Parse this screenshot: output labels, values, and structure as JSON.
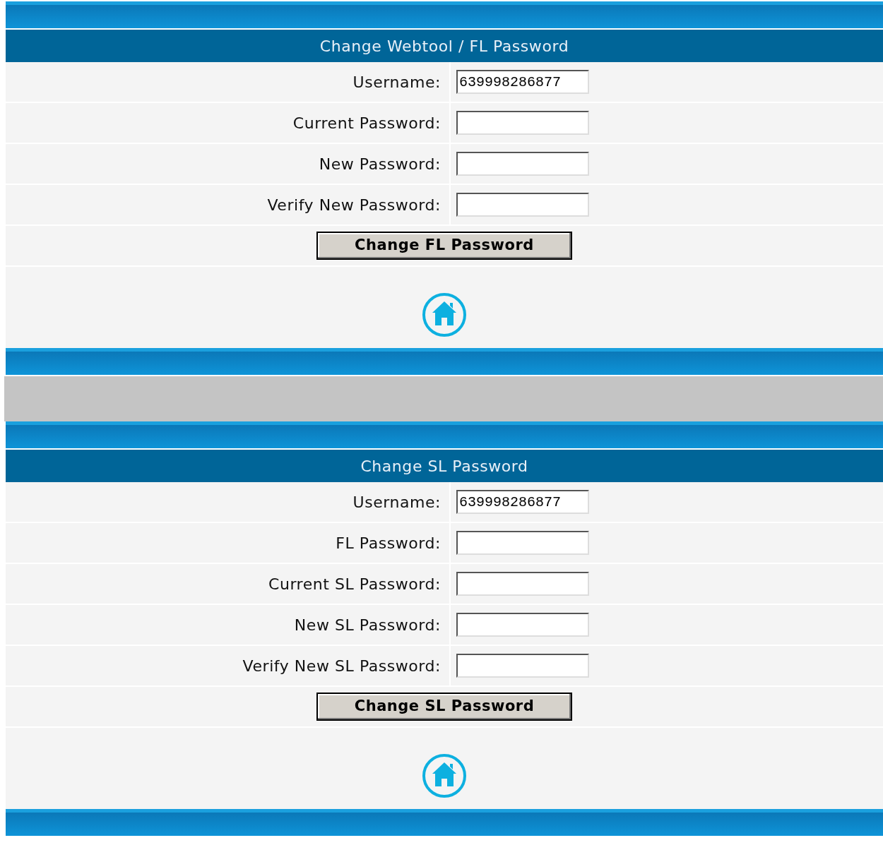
{
  "sections": [
    {
      "title": "Change Webtool / FL Password",
      "fields": [
        {
          "label": "Username:",
          "value": "639998286877"
        },
        {
          "label": "Current Password:"
        },
        {
          "label": "New Password:"
        },
        {
          "label": "Verify New Password:"
        }
      ],
      "button": "Change FL Password"
    },
    {
      "title": "Change SL Password",
      "fields": [
        {
          "label": "Username:",
          "value": "639998286877"
        },
        {
          "label": "FL Password:"
        },
        {
          "label": "Current SL Password:"
        },
        {
          "label": "New SL Password:"
        },
        {
          "label": "Verify New SL Password:"
        }
      ],
      "button": "Change SL Password"
    }
  ]
}
